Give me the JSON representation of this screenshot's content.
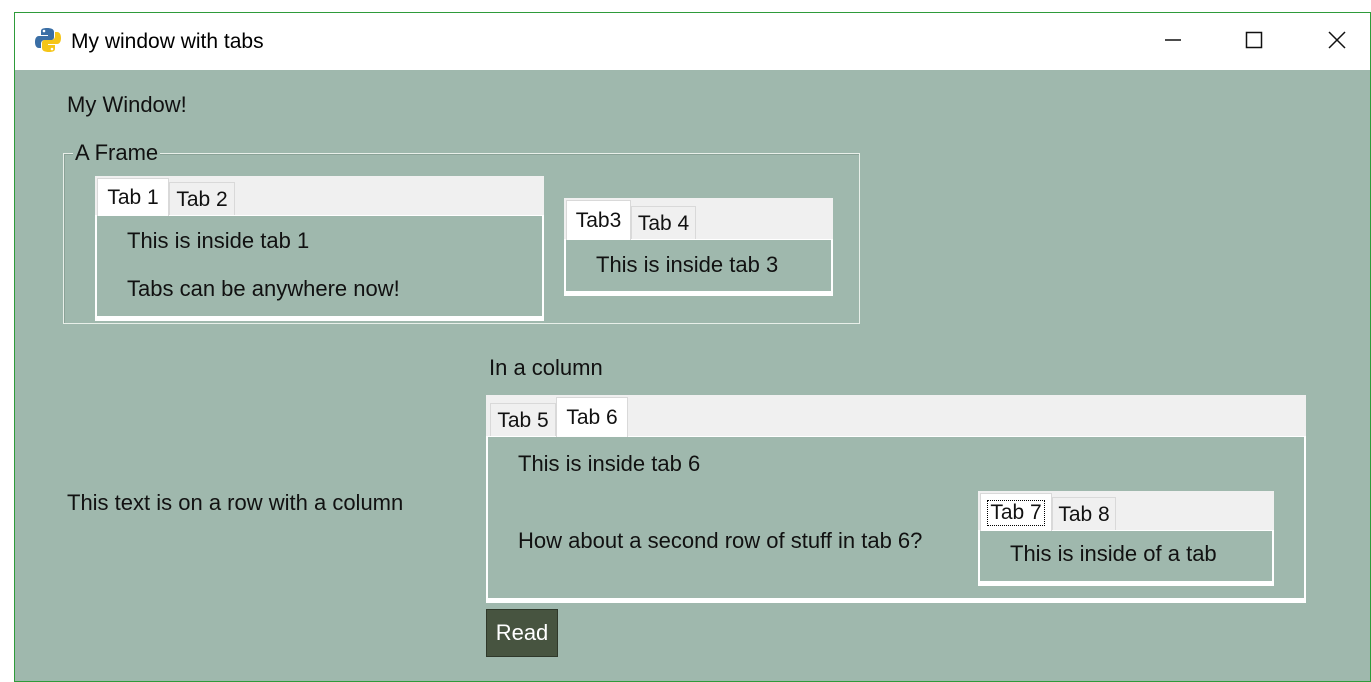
{
  "window": {
    "title": "My window with tabs",
    "controls": {
      "minimize": "minimize",
      "maximize": "maximize",
      "close": "close"
    }
  },
  "main": {
    "heading": "My Window!",
    "frame_title": "A Frame",
    "tabgroup1": {
      "tabs": [
        "Tab 1",
        "Tab 2"
      ],
      "active": "Tab 1",
      "content": [
        "This is inside tab 1",
        "Tabs can be anywhere now!"
      ]
    },
    "tabgroup2": {
      "tabs": [
        "Tab3",
        "Tab 4"
      ],
      "active": "Tab3",
      "content": [
        "This is inside tab 3"
      ]
    },
    "row_text": "This text is on a row with a column",
    "column_label": "In a column",
    "tabgroup3": {
      "tabs": [
        "Tab 5",
        "Tab 6"
      ],
      "active": "Tab 6",
      "content": [
        "This is inside tab 6",
        "How about a second row of stuff in tab 6?"
      ]
    },
    "tabgroup4": {
      "tabs": [
        "Tab 7",
        "Tab 8"
      ],
      "active": "Tab 7",
      "content": [
        "This is inside of a tab"
      ]
    },
    "read_button": "Read"
  },
  "colors": {
    "background": "#9fb8ad",
    "button": "#475440",
    "window_border": "#2e9b3a"
  }
}
